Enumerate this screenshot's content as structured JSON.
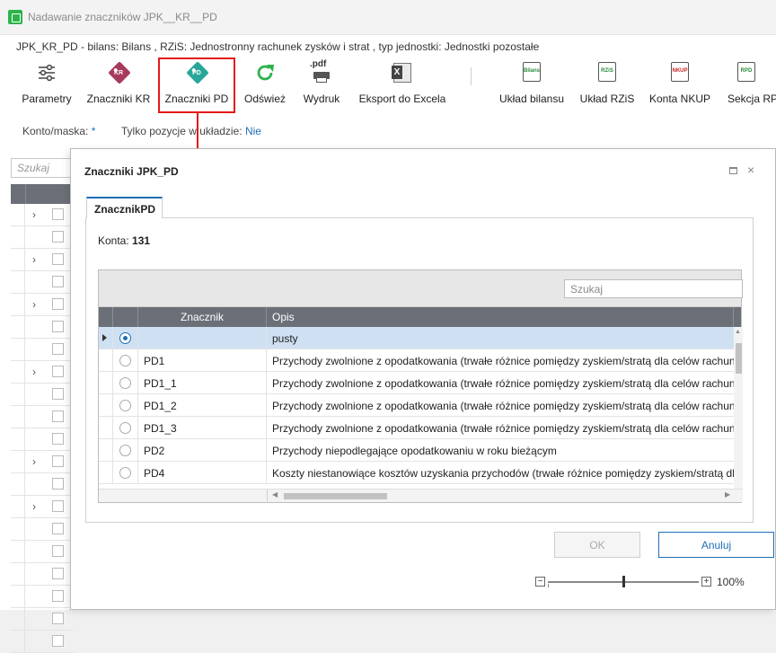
{
  "window": {
    "title": "Nadawanie znaczników JPK__KR__PD"
  },
  "subtitle": "JPK_KR_PD - bilans: Bilans , RZiS: Jednostronny rachunek zysków i strat , typ jednostki: Jednostki pozostałe",
  "toolbar": {
    "parametry": "Parametry",
    "znaczniki_kr": "Znaczniki KR",
    "znaczniki_pd": "Znaczniki PD",
    "odswiez": "Odśwież",
    "wydruk": "Wydruk",
    "eksport": "Eksport do Excela",
    "uklad_bilansu": "Układ bilansu",
    "uklad_rzis": "Układ RZiS",
    "konta_nkup": "Konta NKUP",
    "sekcja_rpd": "Sekcja RPD",
    "icon_texts": {
      "kr": "KR",
      "pd": "PD",
      "pdf": ".pdf",
      "bilans": "Bilans",
      "rzis": "RZiS",
      "nkup": "NKUP",
      "rpd": "RPD",
      "excel": "X"
    }
  },
  "filters": {
    "konto_label": "Konto/maska:",
    "konto_value": "*",
    "tylko_label": "Tylko pozycje w układzie:",
    "tylko_value": "Nie"
  },
  "left_panel": {
    "search_placeholder": "Szukaj",
    "chevron": "›"
  },
  "dialog": {
    "title": "Znaczniki JPK_PD",
    "close": "×",
    "tab": "ZnacznikPD",
    "konta_label": "Konta:",
    "konta_value": "131",
    "search_placeholder": "Szukaj",
    "columns": {
      "znacznik": "Znacznik",
      "opis": "Opis"
    },
    "rows": [
      {
        "znacznik": "",
        "opis": "pusty"
      },
      {
        "znacznik": "PD1",
        "opis": "Przychody zwolnione z opodatkowania (trwałe różnice pomiędzy zyskiem/stratą dla celów rachunkowych"
      },
      {
        "znacznik": "PD1_1",
        "opis": "Przychody zwolnione z opodatkowania (trwałe różnice pomiędzy zyskiem/stratą dla celów rachunkowych"
      },
      {
        "znacznik": "PD1_2",
        "opis": "Przychody zwolnione z opodatkowania (trwałe różnice pomiędzy zyskiem/stratą dla celów rachunkowych"
      },
      {
        "znacznik": "PD1_3",
        "opis": "Przychody zwolnione z opodatkowania (trwałe różnice pomiędzy zyskiem/stratą dla celów rachunkowych"
      },
      {
        "znacznik": "PD2",
        "opis": "Przychody niepodlegające opodatkowaniu w roku bieżącym"
      },
      {
        "znacznik": "PD4",
        "opis": "Koszty niestanowiące kosztów uzyskania przychodów (trwałe różnice pomiędzy zyskiem/stratą dla celów"
      }
    ],
    "ok": "OK",
    "cancel": "Anuluj",
    "zoom": {
      "minus": "−",
      "plus": "+",
      "value": "100%",
      "level": 0.5
    }
  }
}
